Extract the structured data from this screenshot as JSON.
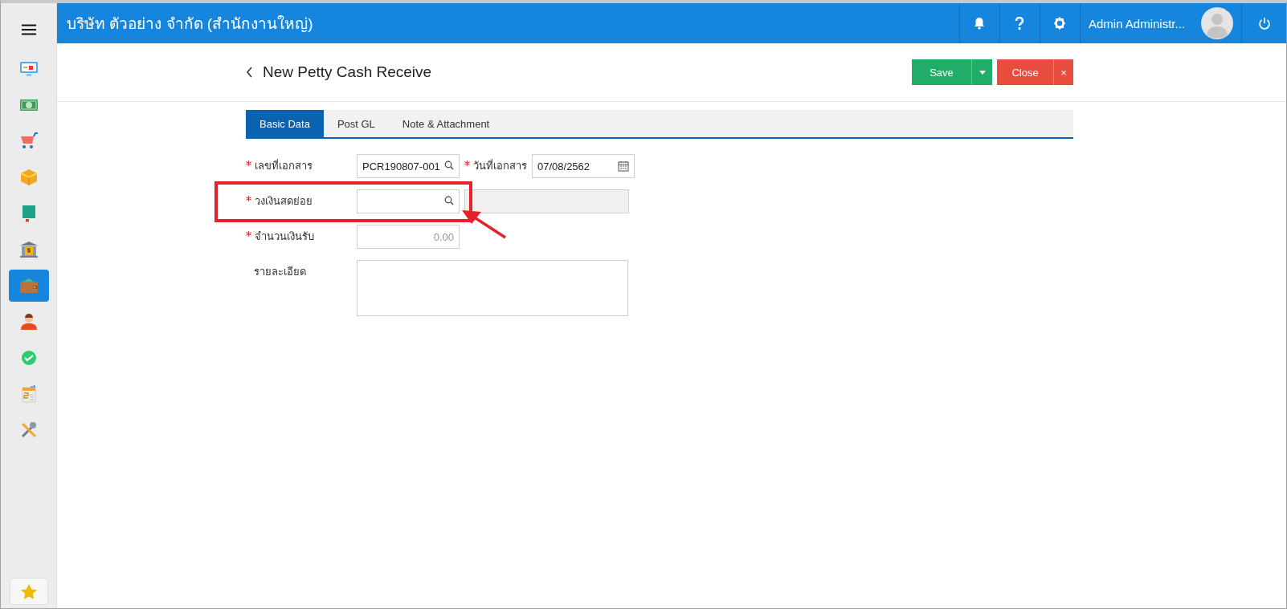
{
  "header": {
    "company": "บริษัท ตัวอย่าง จำกัด (สำนักงานใหญ่)",
    "user": "Admin Administr..."
  },
  "sidebar": {
    "items": [
      {
        "kind": "monitor",
        "selected": false
      },
      {
        "kind": "cash",
        "selected": false
      },
      {
        "kind": "cart",
        "selected": false
      },
      {
        "kind": "box",
        "selected": false
      },
      {
        "kind": "book",
        "selected": false
      },
      {
        "kind": "bank",
        "selected": false
      },
      {
        "kind": "wallet",
        "selected": true
      },
      {
        "kind": "people",
        "selected": false
      },
      {
        "kind": "check",
        "selected": false
      },
      {
        "kind": "report",
        "selected": false
      },
      {
        "kind": "tools",
        "selected": false
      }
    ]
  },
  "page": {
    "title": "New Petty Cash Receive",
    "actions": [
      {
        "kind": "save",
        "label": "Save"
      },
      {
        "kind": "close",
        "label": "Close",
        "dismiss": "×"
      }
    ]
  },
  "tabs": [
    {
      "label": "Basic Data",
      "selected": true
    },
    {
      "label": "Post GL",
      "selected": false
    },
    {
      "label": "Note & Attachment",
      "selected": false
    }
  ],
  "form": {
    "rows": [
      {
        "fields": [
          {
            "label": "เลขที่เอกสาร",
            "required": true,
            "kind": "lookup",
            "value": "PCR190807-001"
          },
          {
            "label": "วันที่เอกสาร",
            "required": true,
            "kind": "date",
            "value": "07/08/2562"
          }
        ]
      },
      {
        "fields": [
          {
            "label": "วงเงินสดย่อย",
            "required": true,
            "kind": "lookup"
          },
          {
            "kind": "readonly"
          }
        ]
      },
      {
        "fields": [
          {
            "label": "จำนวนเงินรับ",
            "required": true,
            "kind": "number",
            "placeholder": "0.00"
          }
        ]
      },
      {
        "fields": [
          {
            "label": "รายละเอียด",
            "required": false,
            "kind": "textarea"
          }
        ]
      }
    ]
  }
}
